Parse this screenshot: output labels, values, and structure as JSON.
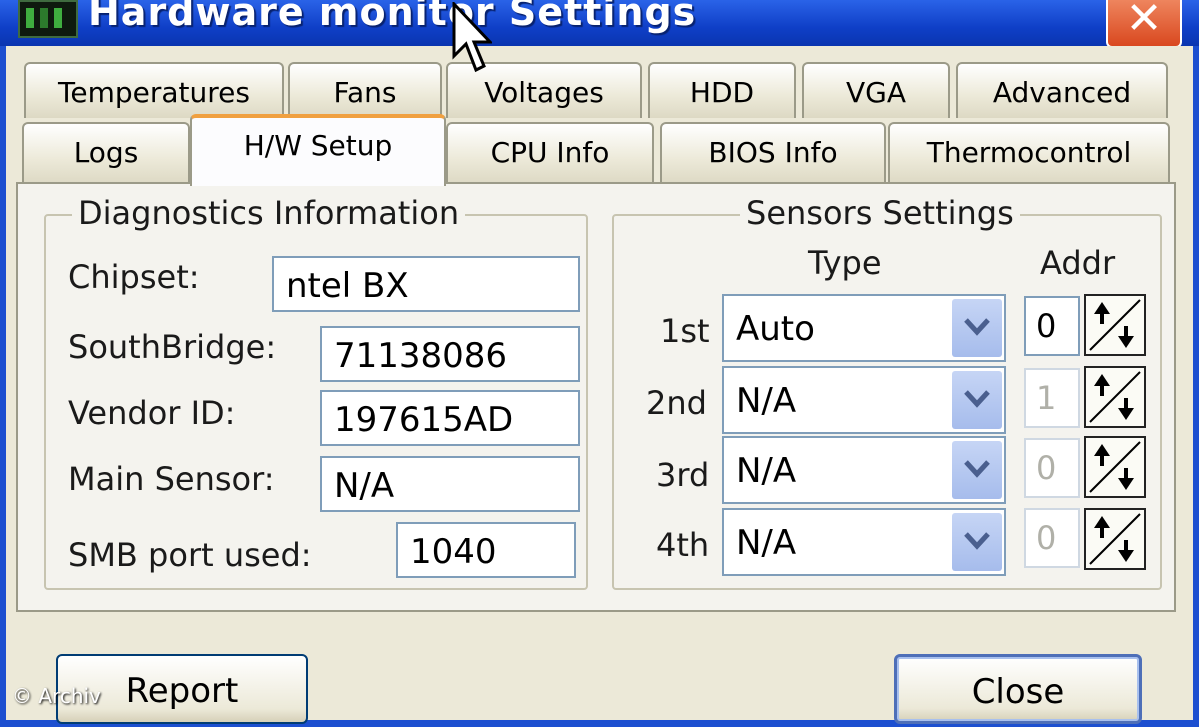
{
  "window": {
    "title": "Hardware monitor Settings",
    "close_glyph": "✕",
    "app_icon": "green-chip-icon"
  },
  "tabs_row1": [
    "Temperatures",
    "Fans",
    "Voltages",
    "HDD",
    "VGA",
    "Advanced"
  ],
  "tabs_row2": [
    "Logs",
    "H/W Setup",
    "CPU Info",
    "BIOS Info",
    "Thermocontrol"
  ],
  "active_tab": "H/W Setup",
  "diagnostics": {
    "title": "Diagnostics Information",
    "chipset_label": "Chipset:",
    "chipset_value": "ntel BX",
    "southbridge_label": "SouthBridge:",
    "southbridge_value": "71138086",
    "vendor_label": "Vendor ID:",
    "vendor_value": "197615AD",
    "main_sensor_label": "Main Sensor:",
    "main_sensor_value": "N/A",
    "smb_label": "SMB port used:",
    "smb_value": "1040"
  },
  "sensors": {
    "title": "Sensors Settings",
    "type_header": "Type",
    "addr_header": "Addr",
    "rows": [
      {
        "label": "1st",
        "type": "Auto",
        "addr": "0"
      },
      {
        "label": "2nd",
        "type": "N/A",
        "addr": "1"
      },
      {
        "label": "3rd",
        "type": "N/A",
        "addr": "0"
      },
      {
        "label": "4th",
        "type": "N/A",
        "addr": "0"
      }
    ]
  },
  "buttons": {
    "report": "Report",
    "close": "Close"
  },
  "watermark": "© Archiv",
  "colors": {
    "titlebar": "#0f3fc7",
    "close": "#d9481f",
    "face": "#ece9d8",
    "tab_accent": "#f0a040"
  }
}
